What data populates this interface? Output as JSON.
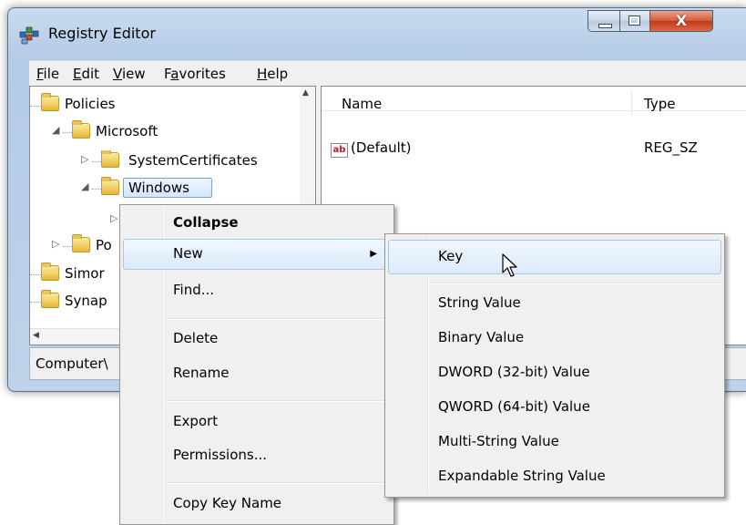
{
  "window": {
    "title": "Registry Editor",
    "close_glyph": "X",
    "app_icon": "registry-icon",
    "menubar": {
      "items": [
        {
          "name": "file",
          "label": "File"
        },
        {
          "name": "edit",
          "label": "Edit"
        },
        {
          "name": "view",
          "label": "View"
        },
        {
          "name": "favorites",
          "label": "Favorites"
        },
        {
          "name": "help",
          "label": "Help"
        }
      ]
    }
  },
  "tree": {
    "items": [
      {
        "label": "Policies"
      },
      {
        "label": "Microsoft"
      },
      {
        "label": "SystemCertificates"
      },
      {
        "label": "Windows"
      },
      {
        "label": "Po"
      },
      {
        "label": "Simor"
      },
      {
        "label": "Synap"
      }
    ]
  },
  "list": {
    "columns": [
      "Name",
      "Type"
    ],
    "rows": [
      {
        "name": "(Default)",
        "type": "REG_SZ",
        "icon": "string-value-icon",
        "icon_text": "ab"
      }
    ]
  },
  "statusbar": {
    "text": "Computer\\"
  },
  "context_menu": {
    "items": [
      "Collapse",
      "New",
      "Find...",
      "Delete",
      "Rename",
      "Export",
      "Permissions...",
      "Copy Key Name"
    ],
    "arrow": "▶"
  },
  "submenu": {
    "items": [
      "Key",
      "String Value",
      "Binary Value",
      "DWORD (32-bit) Value",
      "QWORD (64-bit) Value",
      "Multi-String Value",
      "Expandable String Value"
    ]
  },
  "colors": {
    "highlight_border": "#a8c8ed",
    "close_button": "#c7472a",
    "titlebar": "#b9cfe8"
  }
}
